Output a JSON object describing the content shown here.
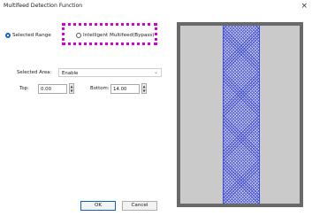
{
  "window": {
    "title": "Multifeed Detection Function",
    "close_glyph": "×"
  },
  "range": {
    "selected_label": "Selected Range",
    "intelligent_label": "Intelligent Multifeed(Bypass)",
    "selected": "Selected Range"
  },
  "area": {
    "label": "Selected Area:",
    "value": "Enable",
    "chevron": "⌄"
  },
  "top": {
    "label": "Top:",
    "value": "0.00"
  },
  "bottom": {
    "label": "Bottom:",
    "value": "14.00"
  },
  "spinner": {
    "up": "▲",
    "down": "▼"
  },
  "buttons": {
    "ok": "OK",
    "cancel": "Cancel"
  },
  "colors": {
    "accent": "#1565c0",
    "highlight": "#d400d4",
    "preview_frame": "#696969",
    "preview_bg": "#cacaca",
    "band_line": "#3346ff"
  }
}
